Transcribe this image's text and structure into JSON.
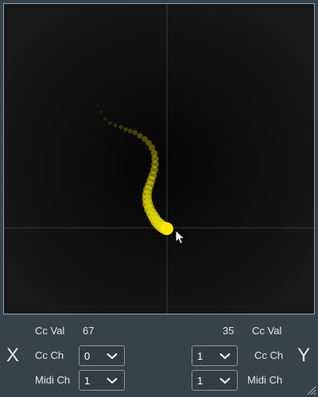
{
  "xy_pad": {
    "trail_color": "#e6dc00",
    "cursor_dot_color": "#ffe600"
  },
  "x_axis": {
    "letter": "X",
    "cc_val_label": "Cc Val",
    "cc_val": "67",
    "cc_ch_label": "Cc Ch",
    "cc_ch_value": "0",
    "midi_ch_label": "Midi Ch",
    "midi_ch_value": "1"
  },
  "y_axis": {
    "letter": "Y",
    "cc_val_label": "Cc Val",
    "cc_val": "35",
    "cc_ch_label": "Cc Ch",
    "cc_ch_value": "1",
    "midi_ch_label": "Midi Ch",
    "midi_ch_value": "1"
  },
  "icons": [
    "mouse-cursor-icon",
    "chevron-down-icon",
    "resize-grip-icon"
  ]
}
